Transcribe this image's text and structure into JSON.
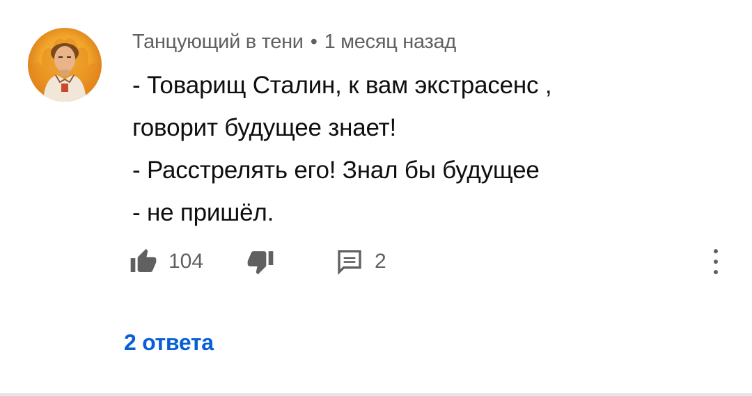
{
  "comment": {
    "author": "Танцующий в тени",
    "separator": "•",
    "time": "1 месяц назад",
    "text_lines": [
      "- Товарищ Сталин, к вам экстрасенс ,",
      "говорит будущее знает!",
      "- Расстрелять его! Знал бы будущее",
      "- не пришёл."
    ],
    "like_count": "104",
    "reply_count": "2",
    "replies_link": "2 ответа"
  },
  "icons": {
    "avatar": "user-avatar",
    "like": "thumb-up-icon",
    "dislike": "thumb-down-icon",
    "reply": "comment-icon",
    "more": "more-vert-icon"
  },
  "colors": {
    "link": "#065fd4",
    "meta_text": "#606060",
    "body_text": "#0f0f0f",
    "icon": "#606060"
  }
}
